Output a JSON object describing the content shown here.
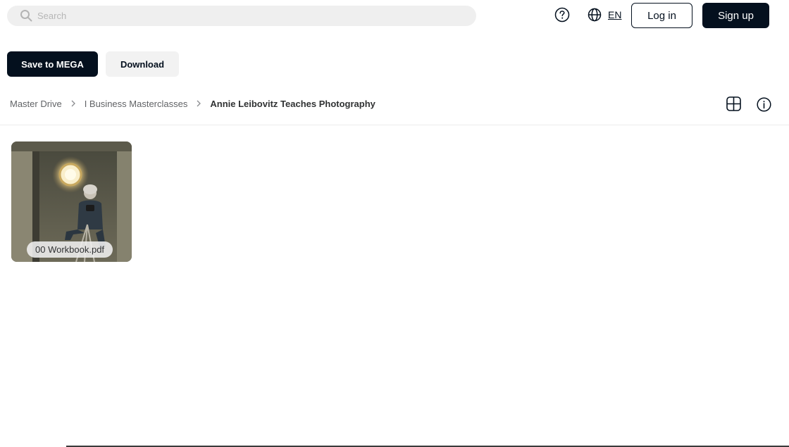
{
  "header": {
    "search_placeholder": "Search",
    "language_code": "EN",
    "login_label": "Log in",
    "signup_label": "Sign up"
  },
  "actions": {
    "save_label": "Save to MEGA",
    "download_label": "Download"
  },
  "breadcrumb": {
    "items": [
      "Master Drive",
      "I Business Masterclasses",
      "Annie Leibovitz Teaches Photography"
    ]
  },
  "view_controls": {
    "grid_icon": "grid-view-icon",
    "info_icon": "info-icon"
  },
  "files": [
    {
      "name": "00 Workbook.pdf",
      "thumbnail": "photo-thumbnail"
    }
  ],
  "colors": {
    "primary": "#04101e",
    "secondary_button": "#f2f2f2",
    "search_bg": "#efefef"
  }
}
